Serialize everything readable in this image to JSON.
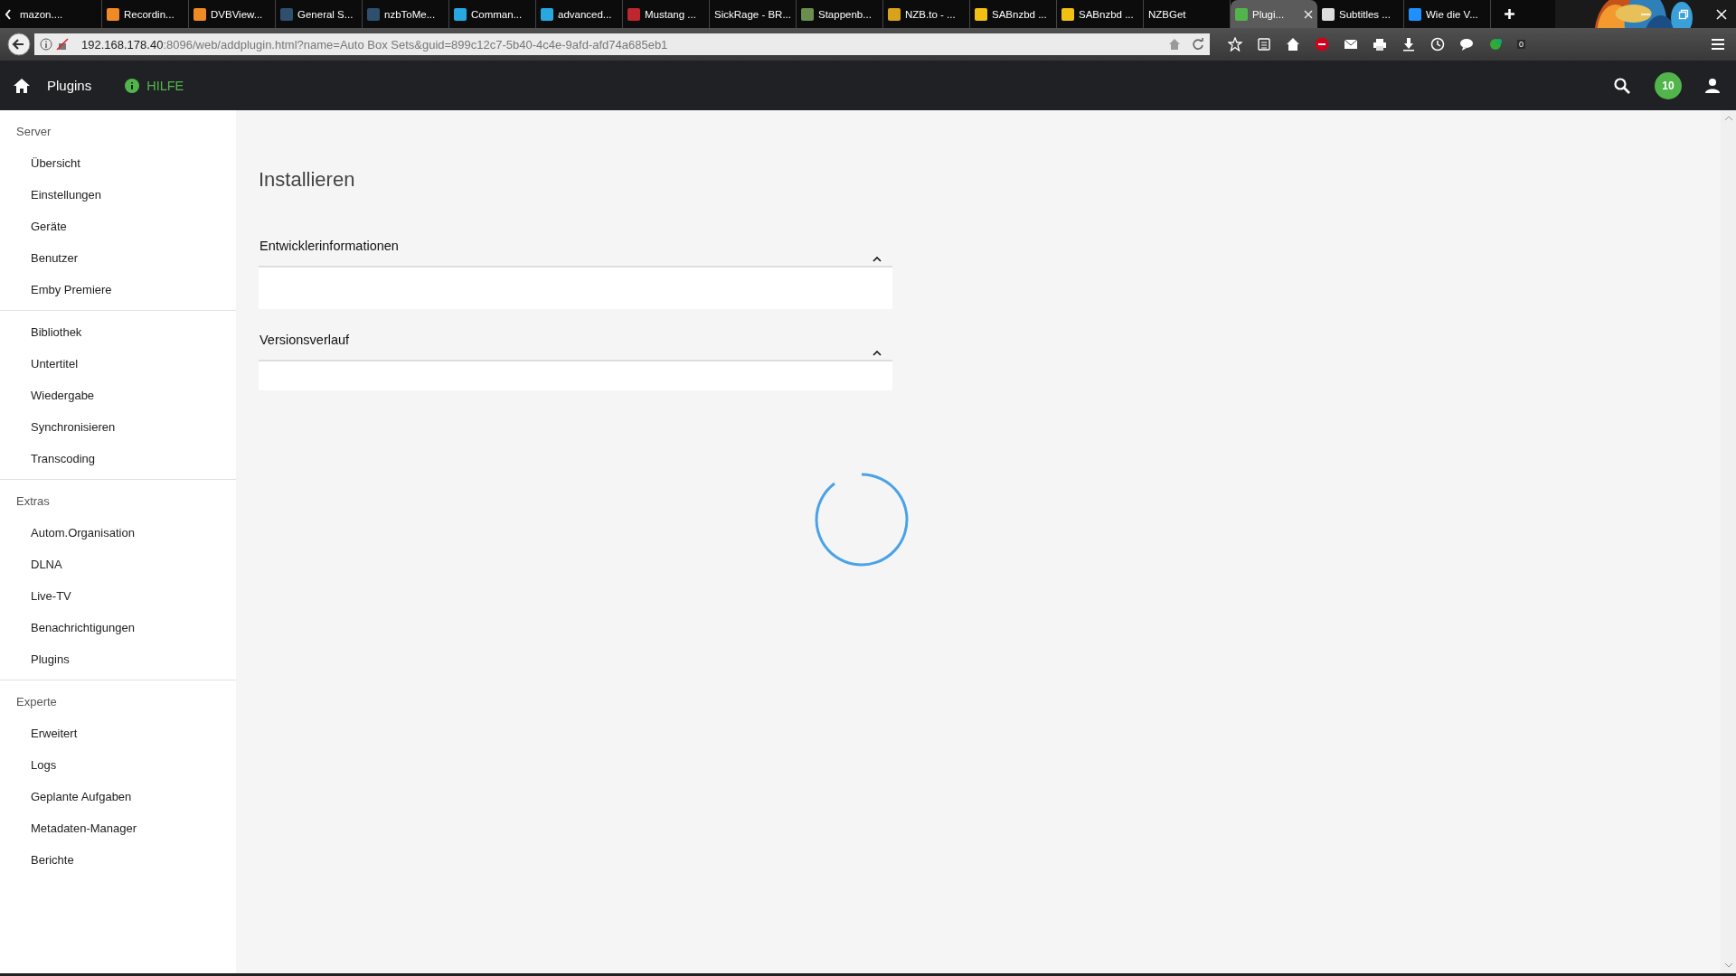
{
  "browser": {
    "tabs": [
      {
        "label": "mazon....",
        "selected": false
      },
      {
        "label": "Recordin...",
        "selected": false,
        "color": "#f08a24"
      },
      {
        "label": "DVBView...",
        "selected": false,
        "color": "#f08a24"
      },
      {
        "label": "General S...",
        "selected": false,
        "color": "#2f4f6f"
      },
      {
        "label": "nzbToMe...",
        "selected": false,
        "color": "#2f4f6f"
      },
      {
        "label": "Comman...",
        "selected": false,
        "color": "#27a8e0"
      },
      {
        "label": "advanced...",
        "selected": false,
        "color": "#27a8e0"
      },
      {
        "label": "Mustang ...",
        "selected": false,
        "color": "#c0262d"
      },
      {
        "label": "SickRage - BR...",
        "selected": false
      },
      {
        "label": "Stappenb...",
        "selected": false,
        "color": "#6b8e4e"
      },
      {
        "label": "NZB.to - ...",
        "selected": false,
        "color": "#d9a21b"
      },
      {
        "label": "SABnzbd ...",
        "selected": false,
        "color": "#f2c012"
      },
      {
        "label": "SABnzbd ...",
        "selected": false,
        "color": "#f2c012"
      },
      {
        "label": "NZBGet",
        "selected": false
      },
      {
        "label": "Plugi...",
        "selected": true,
        "color": "#52b54b"
      },
      {
        "label": "Subtitles ...",
        "selected": false,
        "color": "#dddddd"
      },
      {
        "label": "Wie die V...",
        "selected": false,
        "color": "#1e90ff"
      }
    ],
    "url": {
      "host": "192.168.178.40",
      "path": ":8096/web/addplugin.html?name=Auto Box Sets&guid=899c12c7-5b40-4c4e-9afd-afd74a685eb1"
    },
    "badge": "0"
  },
  "header": {
    "title": "Plugins",
    "help": "HILFE",
    "notifications": "10"
  },
  "sidebar": {
    "sections": [
      {
        "heading": "Server",
        "items": [
          "Übersicht",
          "Einstellungen",
          "Geräte",
          "Benutzer",
          "Emby Premiere"
        ]
      },
      {
        "items": [
          "Bibliothek",
          "Untertitel",
          "Wiedergabe",
          "Synchronisieren",
          "Transcoding"
        ]
      },
      {
        "heading": "Extras",
        "items": [
          "Autom.Organisation",
          "DLNA",
          "Live-TV",
          "Benachrichtigungen",
          "Plugins"
        ]
      },
      {
        "heading": "Experte",
        "items": [
          "Erweitert",
          "Logs",
          "Geplante Aufgaben",
          "Metadaten-Manager",
          "Berichte"
        ]
      }
    ]
  },
  "page": {
    "title": "Installieren",
    "panels": [
      {
        "title": "Entwicklerinformationen",
        "expanded": true
      },
      {
        "title": "Versionsverlauf",
        "expanded": true
      }
    ]
  }
}
